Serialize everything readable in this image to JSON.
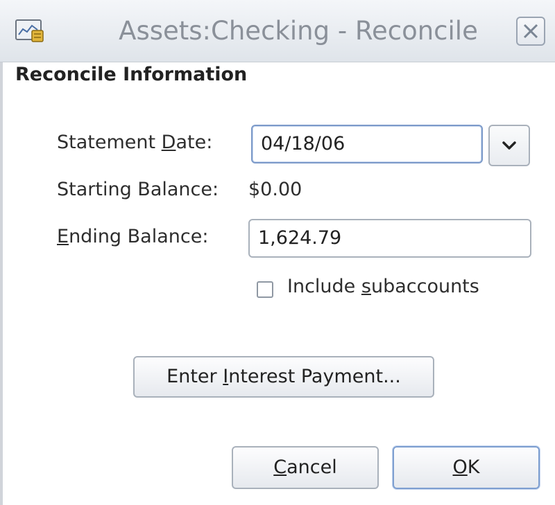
{
  "window": {
    "title": "Assets:Checking - Reconcile"
  },
  "section": {
    "title": "Reconcile Information"
  },
  "statement_date": {
    "label_pre": "Statement ",
    "label_mnemonic": "D",
    "label_post": "ate:",
    "value": "04/18/06"
  },
  "starting_balance": {
    "label": "Starting Balance:",
    "value": "$0.00"
  },
  "ending_balance": {
    "label_mnemonic": "E",
    "label_post": "nding Balance:",
    "value": "1,624.79"
  },
  "include_subaccounts": {
    "label_pre": "Include ",
    "label_mnemonic": "s",
    "label_post": "ubaccounts",
    "checked": false
  },
  "interest_button": {
    "label_pre": "Enter ",
    "label_mnemonic": "I",
    "label_post": "nterest Payment..."
  },
  "cancel_button": {
    "label_mnemonic": "C",
    "label_post": "ancel"
  },
  "ok_button": {
    "label_mnemonic": "O",
    "label_post": "K"
  },
  "icons": {
    "app": "account-icon",
    "close": "close-icon",
    "dropdown": "chevron-down-icon"
  },
  "colors": {
    "title_text": "#8a9099",
    "focus_border": "#7c9ac9",
    "app_icon_accent": "#e0b43a"
  }
}
